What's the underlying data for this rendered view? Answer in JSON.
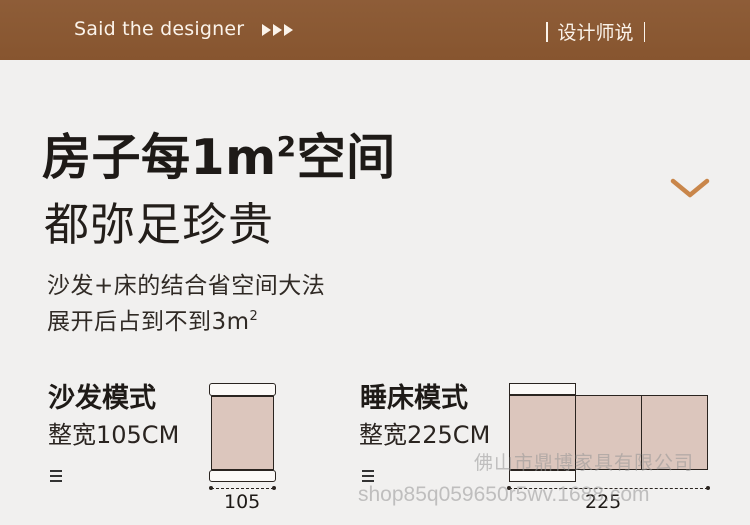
{
  "header": {
    "designer_text": "Said the designer",
    "brand_text": "设计师说"
  },
  "headline": {
    "line1_main": "房子每1m",
    "line1_sup": "2",
    "line1_end": "空间",
    "line2": "都弥足珍贵"
  },
  "description": {
    "line1": "沙发+床的结合省空间大法",
    "line2_main": "展开后占到不到3m",
    "line2_sup": "2"
  },
  "sofa_mode": {
    "title": "沙发模式",
    "width_text": "整宽105CM",
    "dimension_label": "105"
  },
  "bed_mode": {
    "title": "睡床模式",
    "width_text": "整宽225CM",
    "dimension_label": "225"
  },
  "watermark": {
    "line1": "佛山市鼎博家具有限公司",
    "line2": "shop85q059650r5wv.1688.com"
  },
  "colors": {
    "header_bg": "#8b5a34",
    "accent": "#c9864a",
    "cushion_fill": "#dcc6bd"
  }
}
